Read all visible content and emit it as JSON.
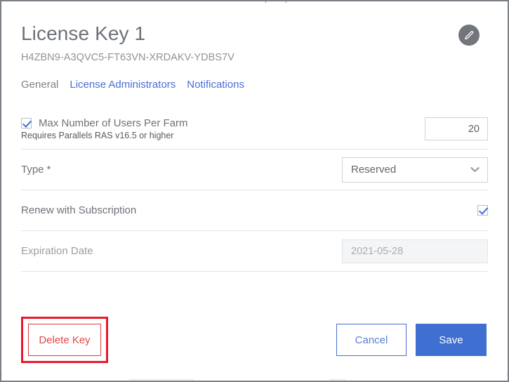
{
  "header": {
    "title": "License Key 1",
    "license_code": "H4ZBN9-A3QVC5-FT63VN-XRDAKV-YDBS7V",
    "edit_icon": "pencil-icon"
  },
  "tabs": [
    {
      "label": "General",
      "active": true
    },
    {
      "label": "License Administrators",
      "active": false
    },
    {
      "label": "Notifications",
      "active": false
    }
  ],
  "form": {
    "max_users": {
      "label": "Max Number of Users Per Farm",
      "hint": "Requires Parallels RAS v16.5 or higher",
      "checked": true,
      "value": "20"
    },
    "type": {
      "label": "Type *",
      "value": "Reserved",
      "chevron_icon": "chevron-down-icon"
    },
    "renew": {
      "label": "Renew with Subscription",
      "checked": true
    },
    "expiration": {
      "label": "Expiration Date",
      "value": "2021-05-28",
      "disabled": true
    }
  },
  "footer": {
    "delete_label": "Delete Key",
    "cancel_label": "Cancel",
    "save_label": "Save"
  },
  "colors": {
    "accent_blue": "#3f6fd0",
    "link_blue": "#4a6fd4",
    "danger_red": "#dc3b3b",
    "annotation_red": "#e8192c",
    "label_gray": "#6d7278",
    "muted_gray": "#9a9ea3",
    "edit_button_gray": "#72767c"
  }
}
